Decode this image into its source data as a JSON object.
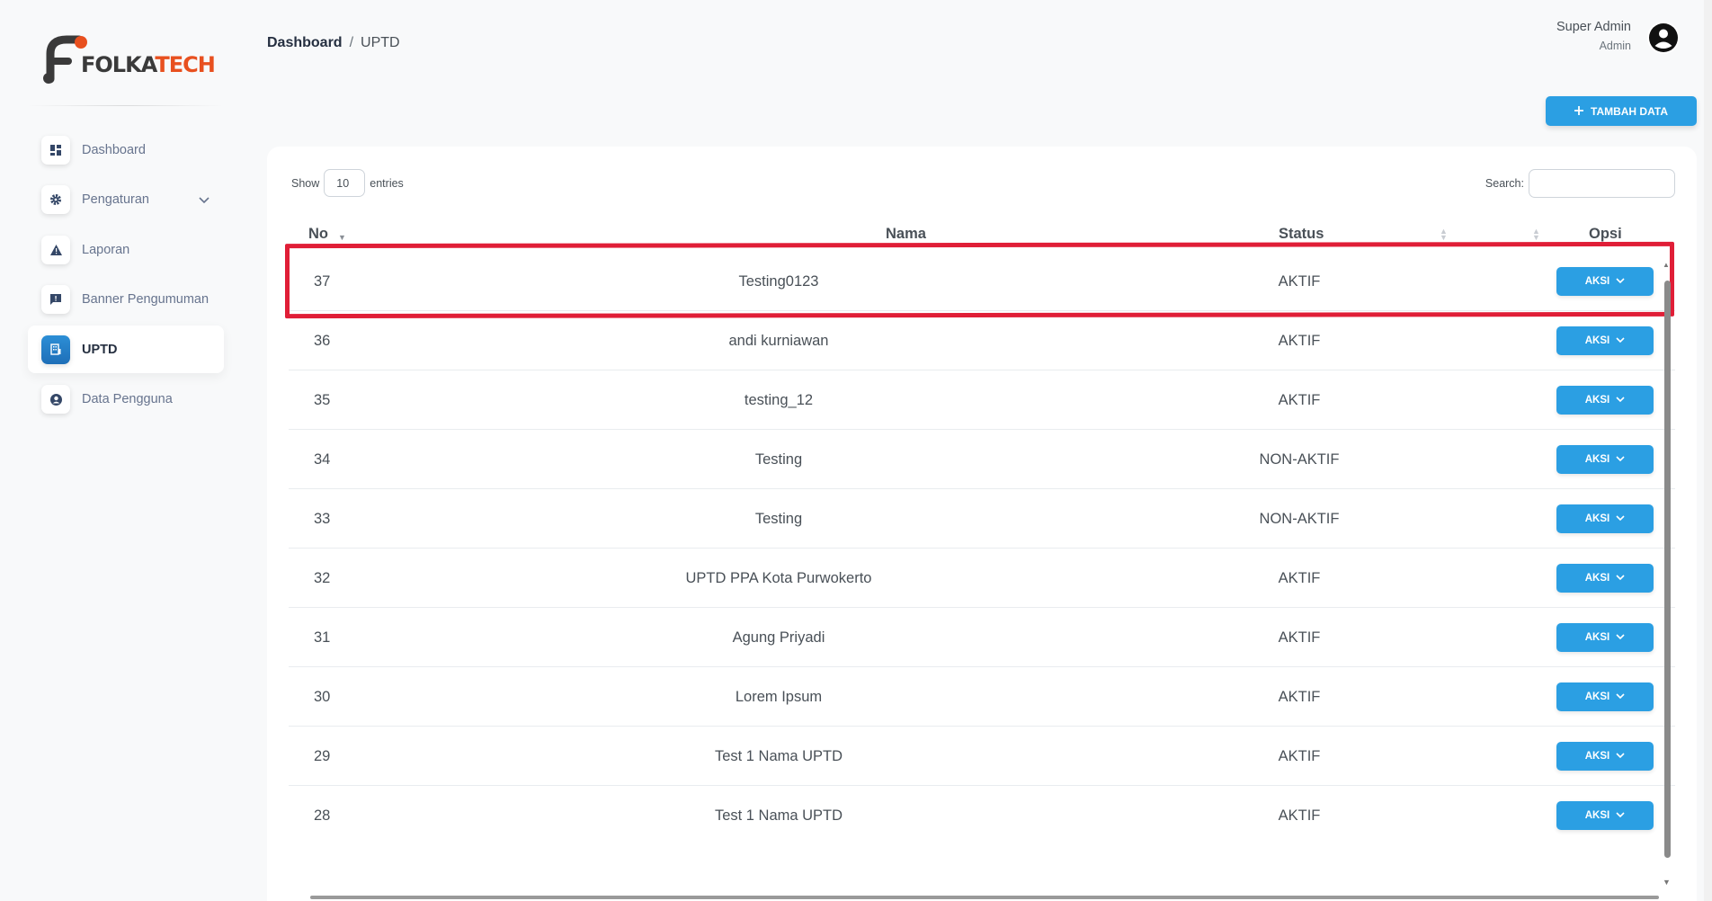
{
  "brand": {
    "logo_text_a": "FOLKA",
    "logo_text_b": "TECH",
    "colors": {
      "dark": "#3a3a3a",
      "orange": "#e8501f"
    }
  },
  "sidebar": {
    "items": [
      {
        "label": "Dashboard",
        "icon": "grid-icon",
        "active": false
      },
      {
        "label": "Pengaturan",
        "icon": "gear-icon",
        "active": false,
        "expandable": true
      },
      {
        "label": "Laporan",
        "icon": "warning-icon",
        "active": false
      },
      {
        "label": "Banner Pengumuman",
        "icon": "announcement-icon",
        "active": false
      },
      {
        "label": "UPTD",
        "icon": "building-icon",
        "active": true
      },
      {
        "label": "Data Pengguna",
        "icon": "user-circle-icon",
        "active": false
      }
    ]
  },
  "header": {
    "breadcrumb": {
      "root": "Dashboard",
      "separator": "/",
      "current": "UPTD"
    },
    "user": {
      "name": "Super Admin",
      "role": "Admin"
    }
  },
  "toolbar": {
    "add_label": "TAMBAH DATA",
    "accent": "#2b9fe3"
  },
  "table_controls": {
    "show_label": "Show",
    "page_length": "10",
    "entries_label": "entries",
    "search_label": "Search:",
    "search_value": ""
  },
  "table": {
    "columns": [
      "No",
      "Nama",
      "Status",
      "Opsi"
    ],
    "action_label": "AKSI",
    "rows": [
      {
        "no": "37",
        "nama": "Testing0123",
        "status": "AKTIF"
      },
      {
        "no": "36",
        "nama": "andi kurniawan",
        "status": "AKTIF"
      },
      {
        "no": "35",
        "nama": "testing_12",
        "status": "AKTIF"
      },
      {
        "no": "34",
        "nama": "Testing",
        "status": "NON-AKTIF"
      },
      {
        "no": "33",
        "nama": "Testing",
        "status": "NON-AKTIF"
      },
      {
        "no": "32",
        "nama": "UPTD PPA Kota Purwokerto",
        "status": "AKTIF"
      },
      {
        "no": "31",
        "nama": "Agung Priyadi",
        "status": "AKTIF"
      },
      {
        "no": "30",
        "nama": "Lorem Ipsum",
        "status": "AKTIF"
      },
      {
        "no": "29",
        "nama": "Test 1 Nama UPTD",
        "status": "AKTIF"
      },
      {
        "no": "28",
        "nama": "Test 1 Nama UPTD",
        "status": "AKTIF"
      }
    ]
  },
  "annotation": {
    "highlight_color": "#e01e37",
    "highlighted_row": "37"
  }
}
